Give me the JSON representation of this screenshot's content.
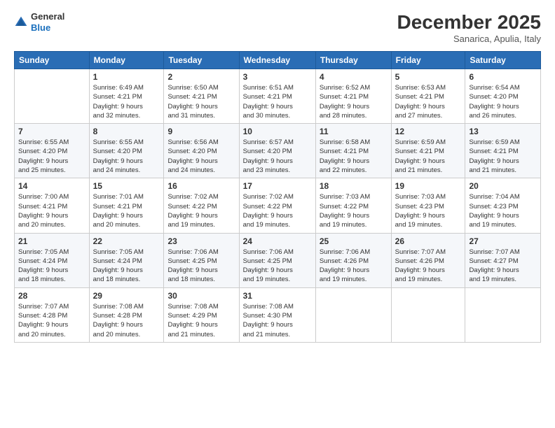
{
  "header": {
    "logo": {
      "line1": "General",
      "line2": "Blue"
    },
    "title": "December 2025",
    "location": "Sanarica, Apulia, Italy"
  },
  "columns": [
    "Sunday",
    "Monday",
    "Tuesday",
    "Wednesday",
    "Thursday",
    "Friday",
    "Saturday"
  ],
  "weeks": [
    [
      {
        "day": "",
        "info": ""
      },
      {
        "day": "1",
        "info": "Sunrise: 6:49 AM\nSunset: 4:21 PM\nDaylight: 9 hours\nand 32 minutes."
      },
      {
        "day": "2",
        "info": "Sunrise: 6:50 AM\nSunset: 4:21 PM\nDaylight: 9 hours\nand 31 minutes."
      },
      {
        "day": "3",
        "info": "Sunrise: 6:51 AM\nSunset: 4:21 PM\nDaylight: 9 hours\nand 30 minutes."
      },
      {
        "day": "4",
        "info": "Sunrise: 6:52 AM\nSunset: 4:21 PM\nDaylight: 9 hours\nand 28 minutes."
      },
      {
        "day": "5",
        "info": "Sunrise: 6:53 AM\nSunset: 4:21 PM\nDaylight: 9 hours\nand 27 minutes."
      },
      {
        "day": "6",
        "info": "Sunrise: 6:54 AM\nSunset: 4:20 PM\nDaylight: 9 hours\nand 26 minutes."
      }
    ],
    [
      {
        "day": "7",
        "info": "Sunrise: 6:55 AM\nSunset: 4:20 PM\nDaylight: 9 hours\nand 25 minutes."
      },
      {
        "day": "8",
        "info": "Sunrise: 6:55 AM\nSunset: 4:20 PM\nDaylight: 9 hours\nand 24 minutes."
      },
      {
        "day": "9",
        "info": "Sunrise: 6:56 AM\nSunset: 4:20 PM\nDaylight: 9 hours\nand 24 minutes."
      },
      {
        "day": "10",
        "info": "Sunrise: 6:57 AM\nSunset: 4:20 PM\nDaylight: 9 hours\nand 23 minutes."
      },
      {
        "day": "11",
        "info": "Sunrise: 6:58 AM\nSunset: 4:21 PM\nDaylight: 9 hours\nand 22 minutes."
      },
      {
        "day": "12",
        "info": "Sunrise: 6:59 AM\nSunset: 4:21 PM\nDaylight: 9 hours\nand 21 minutes."
      },
      {
        "day": "13",
        "info": "Sunrise: 6:59 AM\nSunset: 4:21 PM\nDaylight: 9 hours\nand 21 minutes."
      }
    ],
    [
      {
        "day": "14",
        "info": "Sunrise: 7:00 AM\nSunset: 4:21 PM\nDaylight: 9 hours\nand 20 minutes."
      },
      {
        "day": "15",
        "info": "Sunrise: 7:01 AM\nSunset: 4:21 PM\nDaylight: 9 hours\nand 20 minutes."
      },
      {
        "day": "16",
        "info": "Sunrise: 7:02 AM\nSunset: 4:22 PM\nDaylight: 9 hours\nand 19 minutes."
      },
      {
        "day": "17",
        "info": "Sunrise: 7:02 AM\nSunset: 4:22 PM\nDaylight: 9 hours\nand 19 minutes."
      },
      {
        "day": "18",
        "info": "Sunrise: 7:03 AM\nSunset: 4:22 PM\nDaylight: 9 hours\nand 19 minutes."
      },
      {
        "day": "19",
        "info": "Sunrise: 7:03 AM\nSunset: 4:23 PM\nDaylight: 9 hours\nand 19 minutes."
      },
      {
        "day": "20",
        "info": "Sunrise: 7:04 AM\nSunset: 4:23 PM\nDaylight: 9 hours\nand 19 minutes."
      }
    ],
    [
      {
        "day": "21",
        "info": "Sunrise: 7:05 AM\nSunset: 4:24 PM\nDaylight: 9 hours\nand 18 minutes."
      },
      {
        "day": "22",
        "info": "Sunrise: 7:05 AM\nSunset: 4:24 PM\nDaylight: 9 hours\nand 18 minutes."
      },
      {
        "day": "23",
        "info": "Sunrise: 7:06 AM\nSunset: 4:25 PM\nDaylight: 9 hours\nand 18 minutes."
      },
      {
        "day": "24",
        "info": "Sunrise: 7:06 AM\nSunset: 4:25 PM\nDaylight: 9 hours\nand 19 minutes."
      },
      {
        "day": "25",
        "info": "Sunrise: 7:06 AM\nSunset: 4:26 PM\nDaylight: 9 hours\nand 19 minutes."
      },
      {
        "day": "26",
        "info": "Sunrise: 7:07 AM\nSunset: 4:26 PM\nDaylight: 9 hours\nand 19 minutes."
      },
      {
        "day": "27",
        "info": "Sunrise: 7:07 AM\nSunset: 4:27 PM\nDaylight: 9 hours\nand 19 minutes."
      }
    ],
    [
      {
        "day": "28",
        "info": "Sunrise: 7:07 AM\nSunset: 4:28 PM\nDaylight: 9 hours\nand 20 minutes."
      },
      {
        "day": "29",
        "info": "Sunrise: 7:08 AM\nSunset: 4:28 PM\nDaylight: 9 hours\nand 20 minutes."
      },
      {
        "day": "30",
        "info": "Sunrise: 7:08 AM\nSunset: 4:29 PM\nDaylight: 9 hours\nand 21 minutes."
      },
      {
        "day": "31",
        "info": "Sunrise: 7:08 AM\nSunset: 4:30 PM\nDaylight: 9 hours\nand 21 minutes."
      },
      {
        "day": "",
        "info": ""
      },
      {
        "day": "",
        "info": ""
      },
      {
        "day": "",
        "info": ""
      }
    ]
  ]
}
